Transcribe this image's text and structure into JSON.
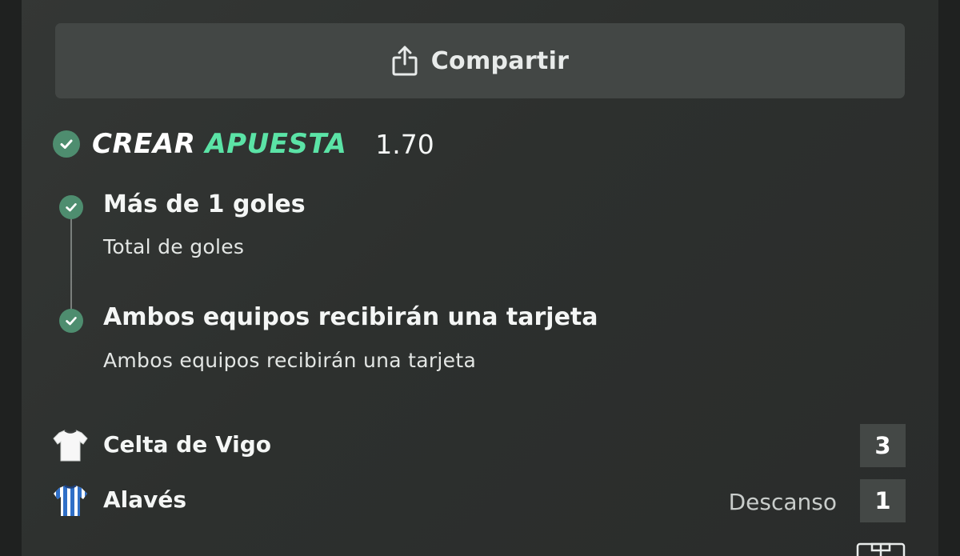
{
  "share": {
    "label": "Compartir",
    "icon": "share-icon"
  },
  "bet_builder": {
    "title_part1": "CREAR",
    "title_part2": "APUESTA",
    "odds": "1.70",
    "accent_color": "#5be3a6",
    "check_color": "#4e8d6f",
    "legs": [
      {
        "title": "Más de 1 goles",
        "subtitle": "Total de goles",
        "status": "won"
      },
      {
        "title": "Ambos equipos recibirán una tarjeta",
        "subtitle": "Ambos equipos recibirán una tarjeta",
        "status": "won"
      }
    ]
  },
  "match": {
    "status": "Descanso",
    "teams": [
      {
        "name": "Celta de Vigo",
        "score": "3",
        "shirt": "white-shirt-icon"
      },
      {
        "name": "Alavés",
        "score": "1",
        "shirt": "blue-striped-shirt-icon"
      }
    ]
  }
}
